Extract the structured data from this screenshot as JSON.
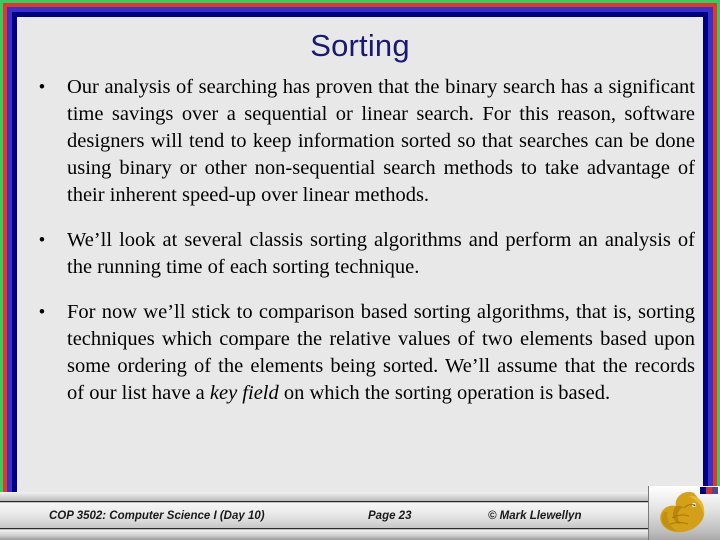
{
  "slide": {
    "title": "Sorting",
    "background_color": "#e8e8e8",
    "title_color": "#191970",
    "border_colors": {
      "outer_green": "#33cc66",
      "red": "#ee3322",
      "blue": "#3333cc",
      "inner_navy": "#000080"
    },
    "bullets": [
      {
        "marker": "•",
        "text_parts": [
          {
            "style": "normal",
            "text": "Our analysis of searching has proven that the binary search has a significant time savings over a sequential or linear search.  For this reason, software designers will tend to keep information sorted so that searches can be done using binary or other non-sequential search methods to take advantage of their inherent speed-up over linear methods."
          }
        ]
      },
      {
        "marker": "•",
        "text_parts": [
          {
            "style": "normal",
            "text": "We’ll look at several classis sorting algorithms and perform an analysis of the running time of each sorting technique."
          }
        ]
      },
      {
        "marker": "•",
        "text_parts": [
          {
            "style": "normal",
            "text": "For now we’ll stick to comparison based sorting algorithms, that is, sorting techniques which compare the relative values of two elements based upon some ordering of the elements being sorted.  We’ll assume that the records of our list have a "
          },
          {
            "style": "italic",
            "text": "key field"
          },
          {
            "style": "normal",
            "text": " on which the sorting operation is based."
          }
        ]
      }
    ]
  },
  "footer": {
    "course": "COP 3502: Computer Science I  (Day 10)",
    "page": "Page 23",
    "copyright": "© Mark Llewellyn",
    "logo_name": "ucf-pegasus-logo",
    "logo_color": "#d4a017"
  }
}
